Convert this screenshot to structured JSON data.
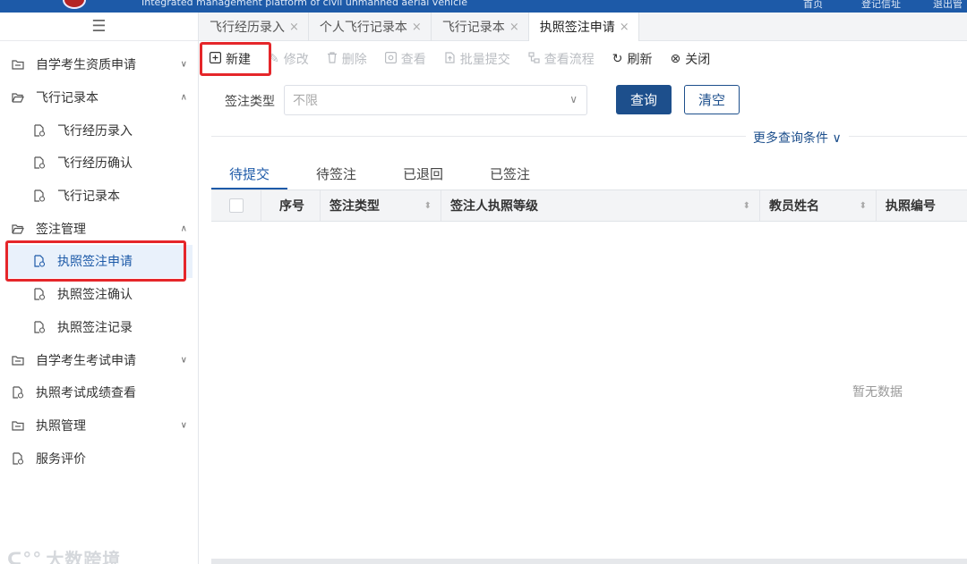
{
  "header": {
    "subtitle": "Integrated management platform of civil unmanned aerial vehicle",
    "nav": [
      "首页",
      "登记信址",
      "退出管"
    ]
  },
  "sidebar": {
    "items": [
      {
        "label": "自学考生资质申请",
        "level": 0,
        "icon": "folder-icon",
        "arrow": "chevron-down"
      },
      {
        "label": "飞行记录本",
        "level": 0,
        "icon": "folder-open-icon",
        "arrow": "chevron-up"
      },
      {
        "label": "飞行经历录入",
        "level": 1,
        "icon": "document-icon"
      },
      {
        "label": "飞行经历确认",
        "level": 1,
        "icon": "document-icon"
      },
      {
        "label": "飞行记录本",
        "level": 1,
        "icon": "document-icon"
      },
      {
        "label": "签注管理",
        "level": 0,
        "icon": "folder-open-icon",
        "arrow": "chevron-up"
      },
      {
        "label": "执照签注申请",
        "level": 1,
        "icon": "document-icon",
        "active": true
      },
      {
        "label": "执照签注确认",
        "level": 1,
        "icon": "document-icon"
      },
      {
        "label": "执照签注记录",
        "level": 1,
        "icon": "document-icon"
      },
      {
        "label": "自学考生考试申请",
        "level": 0,
        "icon": "folder-icon",
        "arrow": "chevron-down"
      },
      {
        "label": "执照考试成绩查看",
        "level": 0,
        "icon": "document-icon"
      },
      {
        "label": "执照管理",
        "level": 0,
        "icon": "folder-icon",
        "arrow": "chevron-down"
      },
      {
        "label": "服务评价",
        "level": 0,
        "icon": "document-icon"
      }
    ],
    "watermark": "大数跨境"
  },
  "tabs": [
    {
      "label": "飞行经历录入",
      "active": false
    },
    {
      "label": "个人飞行记录本",
      "active": false
    },
    {
      "label": "飞行记录本",
      "active": false
    },
    {
      "label": "执照签注申请",
      "active": true
    }
  ],
  "toolbar": {
    "new": "新建",
    "edit": "修改",
    "delete": "删除",
    "view": "查看",
    "batch_submit": "批量提交",
    "view_flow": "查看流程",
    "refresh": "刷新",
    "close": "关闭"
  },
  "filter": {
    "label": "签注类型",
    "placeholder": "不限",
    "query": "查询",
    "clear": "清空",
    "more": "更多查询条件"
  },
  "status_tabs": [
    "待提交",
    "待签注",
    "已退回",
    "已签注"
  ],
  "table": {
    "columns": [
      "序号",
      "签注类型",
      "签注人执照等级",
      "教员姓名",
      "执照编号"
    ],
    "empty_text": "暂无数据"
  },
  "colors": {
    "primary": "#1d4f8c",
    "header_bg": "#1d5aa8",
    "highlight_box": "#e5262a"
  }
}
